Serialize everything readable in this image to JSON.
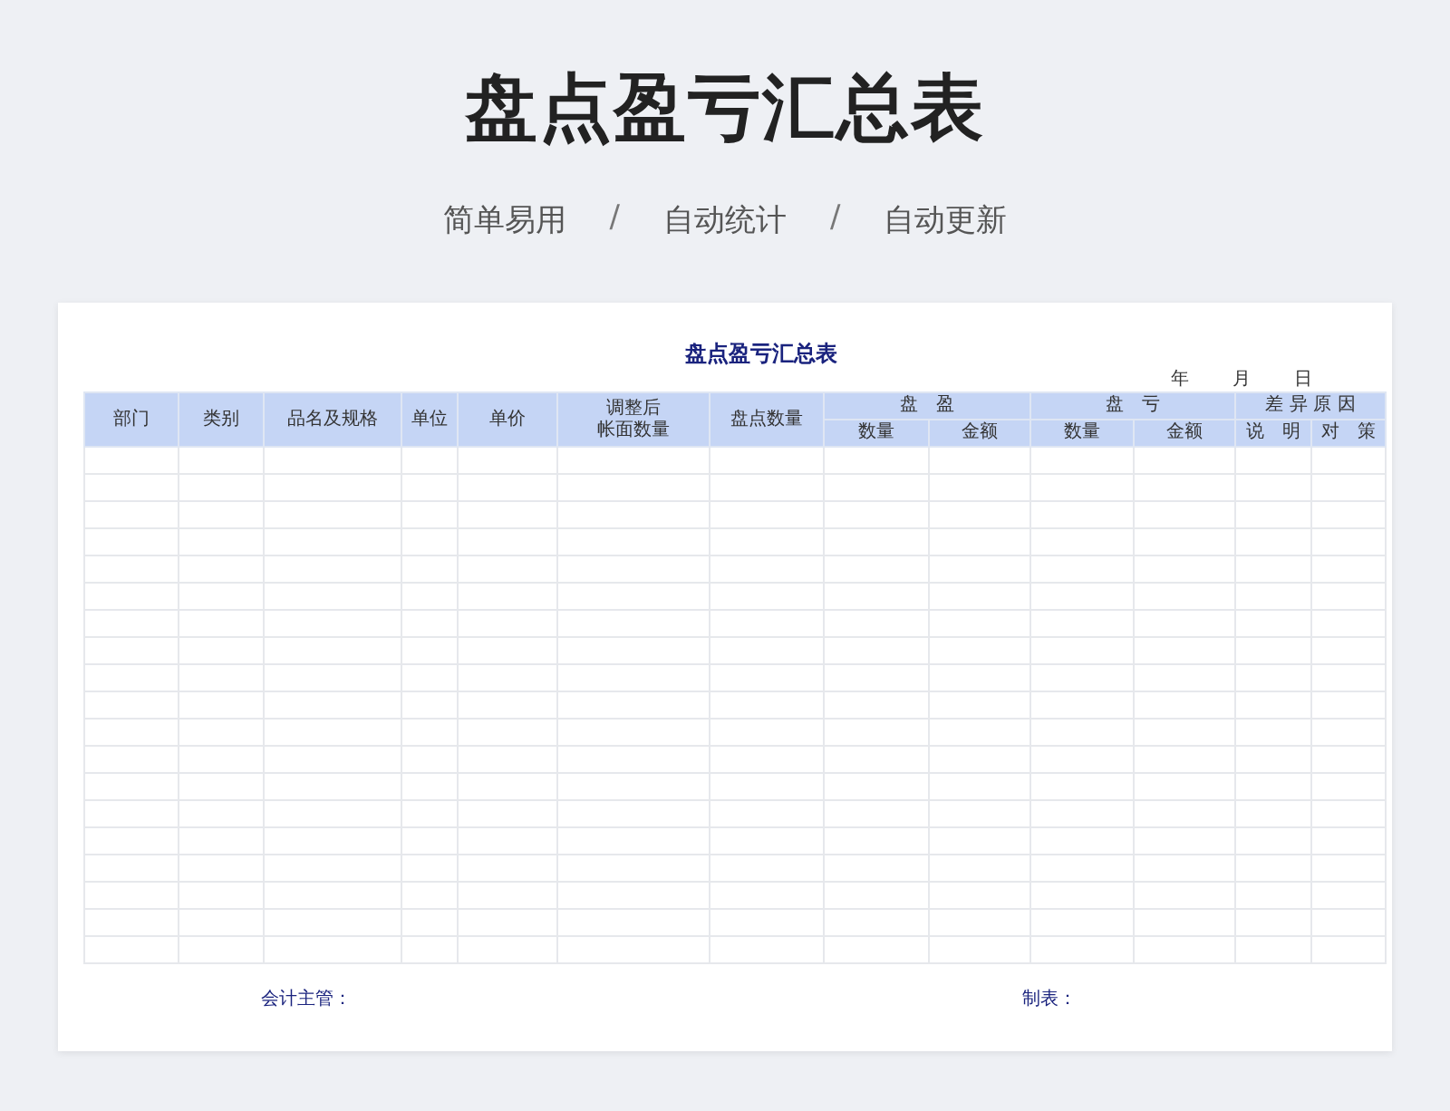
{
  "page_title": "盘点盈亏汇总表",
  "taglines": [
    {
      "kind": "text",
      "text": "简单易用"
    },
    {
      "kind": "separator",
      "text": "/"
    },
    {
      "kind": "text",
      "text": "自动统计"
    },
    {
      "kind": "separator",
      "text": "/"
    },
    {
      "kind": "text",
      "text": "自动更新"
    }
  ],
  "sheet": {
    "title": "盘点盈亏汇总表",
    "date_labels": [
      "年",
      "月",
      "日"
    ],
    "columns": [
      {
        "label": "部门"
      },
      {
        "label": "类别"
      },
      {
        "label": "品名及规格"
      },
      {
        "label": "单位"
      },
      {
        "label": "单价"
      },
      {
        "lines": [
          "调整后",
          "帐面数量"
        ]
      },
      {
        "label": "盘点数量"
      },
      {
        "label": "盘　盈",
        "children": [
          "数量",
          "金额"
        ]
      },
      {
        "label": "盘　亏",
        "children": [
          "数量",
          "金额"
        ]
      },
      {
        "label": "差 异 原 因",
        "children": [
          "说　明",
          "对　策"
        ]
      }
    ],
    "footer": [
      "会计主管：",
      "制表："
    ]
  }
}
